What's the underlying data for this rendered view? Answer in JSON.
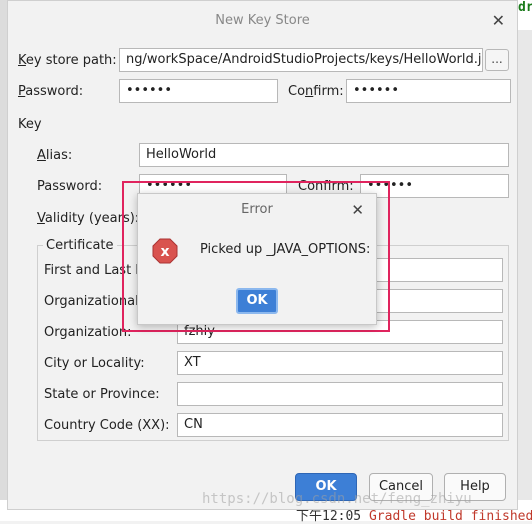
{
  "dialog": {
    "title": "New Key Store",
    "keystore_path_label": "Key store path:",
    "keystore_path_value": "ng/workSpace/AndroidStudioProjects/keys/HelloWorld.jks",
    "browse_label": "...",
    "password_label": "Password:",
    "password_value": "••••••",
    "confirm_label": "Confirm:",
    "confirm_value": "••••••",
    "key_section": "Key",
    "alias_label": "Alias:",
    "alias_value": "HelloWorld",
    "key_password_label": "Password:",
    "key_password_value": "••••••",
    "key_confirm_label": "Confirm:",
    "key_confirm_value": "••••••",
    "validity_label": "Validity (years):",
    "certificate_section": "Certificate",
    "first_last_label": "First and Last Na",
    "org_unit_label": "Organizational U",
    "organization_label": "Organization:",
    "organization_value": "fzhiy",
    "city_label": "City or Locality:",
    "city_value": "XT",
    "state_label": "State or Province:",
    "state_value": "",
    "country_label": "Country Code (XX):",
    "country_value": "CN",
    "ok_label": "OK",
    "cancel_label": "Cancel",
    "help_label": "Help"
  },
  "error_popup": {
    "title": "Error",
    "message": "Picked up _JAVA_OPTIONS:",
    "ok_label": "OK"
  },
  "background": {
    "gradle_time": "下午12:05",
    "gradle_text": "Gradle build finished",
    "top_right": "dr",
    "jks_fragment": "jks"
  },
  "watermark": "https://blog.csdn.net/feng_zhiyu",
  "colors": {
    "accent": "#3d7fd6",
    "highlight": "#e0245e",
    "error_icon": "#d9534f"
  }
}
